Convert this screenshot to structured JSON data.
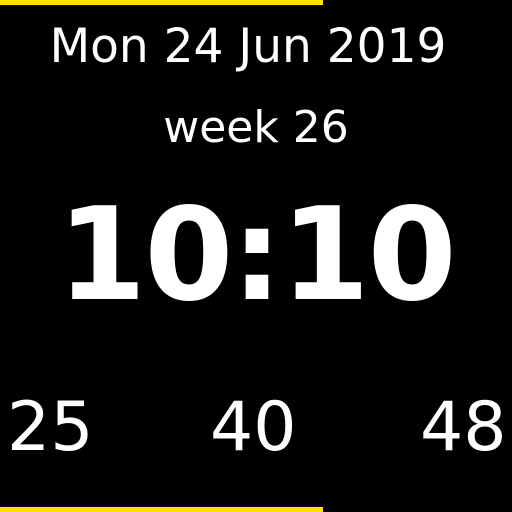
{
  "date": "Mon 24 Jun 2019",
  "week": "week 26",
  "time": "10:10",
  "stats": [
    "25",
    "40",
    "48"
  ],
  "colors": {
    "background": "#000000",
    "text": "#ffffff",
    "accent_bar": "#ffe000"
  }
}
